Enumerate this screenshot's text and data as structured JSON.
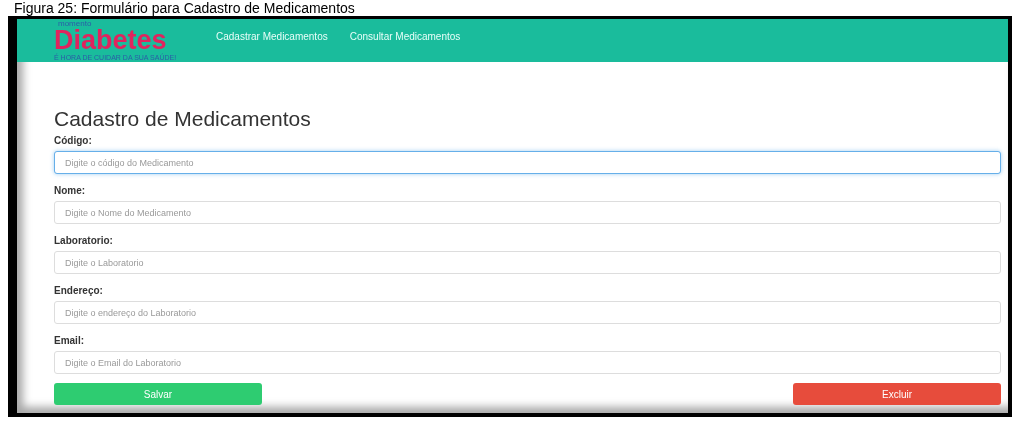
{
  "caption": "Figura 25: Formulário para Cadastro de Medicamentos",
  "navbar": {
    "logo": {
      "top": "momento",
      "main": "Diabetes",
      "tagline": "É HORA DE CUIDAR DA SUA SAÚDE!"
    },
    "links": [
      {
        "label": "Cadastrar Medicamentos"
      },
      {
        "label": "Consultar Medicamentos"
      }
    ]
  },
  "form": {
    "title": "Cadastro de Medicamentos",
    "fields": [
      {
        "label": "Código:",
        "placeholder": "Digite o código do Medicamento",
        "focused": true
      },
      {
        "label": "Nome:",
        "placeholder": "Digite o Nome do Medicamento",
        "focused": false
      },
      {
        "label": "Laboratorio:",
        "placeholder": "Digite o Laboratorio",
        "focused": false
      },
      {
        "label": "Endereço:",
        "placeholder": "Digite o endereço do Laboratorio",
        "focused": false
      },
      {
        "label": "Email:",
        "placeholder": "Digite o Email do Laboratorio",
        "focused": false
      }
    ],
    "buttons": [
      {
        "label": "Salvar",
        "kind": "save"
      },
      {
        "label": "Excluir",
        "kind": "delete"
      }
    ]
  }
}
